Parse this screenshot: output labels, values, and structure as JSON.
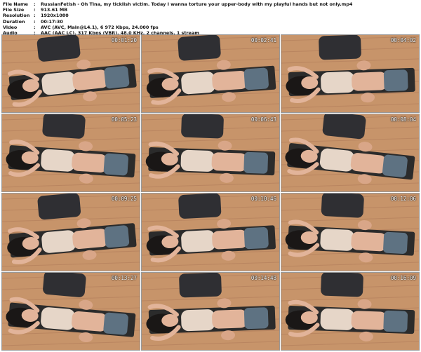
{
  "info": [
    {
      "key": "File Name",
      "value": "RussianFetish - Oh Tina, my ticklish victim. Today I wanna torture your upper-body with my playful hands but not only.mp4"
    },
    {
      "key": "File Size",
      "value": "913.61 MB"
    },
    {
      "key": "Resolution",
      "value": "1920x1080"
    },
    {
      "key": "Duration",
      "value": "00:17:30"
    },
    {
      "key": "Video",
      "value": "AVC (AVC, Main@L4.1), 6 972 Kbps, 24.000 fps"
    },
    {
      "key": "Audio",
      "value": "AAC (AAC LC), 317 Kbps (VBR), 48.0 KHz, 2 channels, 1 stream"
    }
  ],
  "separator": ":",
  "thumbnails": [
    {
      "timestamp": "00:01:20"
    },
    {
      "timestamp": "00:02:41"
    },
    {
      "timestamp": "00:04:02"
    },
    {
      "timestamp": "00:05:23"
    },
    {
      "timestamp": "00:06:43"
    },
    {
      "timestamp": "00:08:04"
    },
    {
      "timestamp": "00:09:25"
    },
    {
      "timestamp": "00:10:46"
    },
    {
      "timestamp": "00:12:06"
    },
    {
      "timestamp": "00:13:27"
    },
    {
      "timestamp": "00:14:48"
    },
    {
      "timestamp": "00:16:09"
    }
  ],
  "colors": {
    "floor": "#c7946a",
    "bench": "#2b2b2b",
    "top": "#e6d6c8",
    "skin": "#e2b49a",
    "hair": "#1a1716",
    "shorts": "#5e7282",
    "timestamp": "#ffffff"
  }
}
